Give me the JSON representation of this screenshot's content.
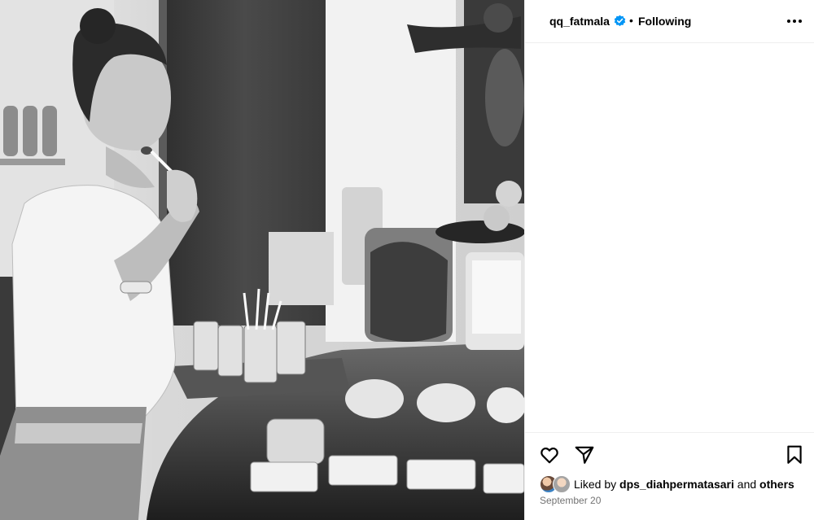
{
  "post": {
    "username": "qq_fatmala",
    "separator": "•",
    "follow_status": "Following",
    "liked_by_prefix": "Liked by",
    "liked_by_user": "dps_diahpermatasari",
    "liked_by_and": "and",
    "liked_by_others": "others",
    "date": "September 20"
  },
  "photo": {
    "description_icon": "black-and-white-photo"
  },
  "icons": {
    "verified": "verified-badge-icon",
    "more": "more-options-icon",
    "like": "heart-icon",
    "share": "paper-plane-icon",
    "save": "bookmark-icon"
  },
  "colors": {
    "verified_blue": "#0095f6",
    "secondary_text": "#737373",
    "divider": "#efefef"
  }
}
